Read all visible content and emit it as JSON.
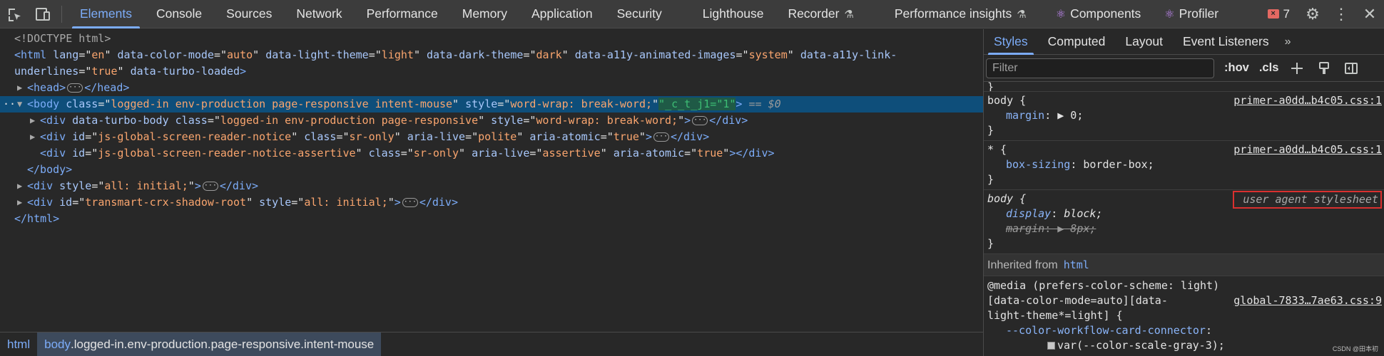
{
  "toolbar": {
    "tabs": [
      {
        "label": "Elements"
      },
      {
        "label": "Console"
      },
      {
        "label": "Sources"
      },
      {
        "label": "Network"
      },
      {
        "label": "Performance"
      },
      {
        "label": "Memory"
      },
      {
        "label": "Application"
      },
      {
        "label": "Security"
      },
      {
        "label": "Lighthouse"
      },
      {
        "label": "Recorder"
      },
      {
        "label": "Performance insights"
      },
      {
        "label": "Components"
      },
      {
        "label": "Profiler"
      }
    ],
    "active_tab": "Elements",
    "error_count": "7",
    "icons": [
      "inspect-element-icon",
      "device-toolbar-icon",
      "beaker-icon",
      "react-icon",
      "gear-icon",
      "kebab-menu-icon",
      "close-icon"
    ]
  },
  "dom": {
    "doctype": "<!DOCTYPE html>",
    "html_open": {
      "tag": "html",
      "attrs": [
        {
          "n": "lang",
          "v": "en"
        },
        {
          "n": "data-color-mode",
          "v": "auto"
        },
        {
          "n": "data-light-theme",
          "v": "light"
        },
        {
          "n": "data-dark-theme",
          "v": "dark"
        },
        {
          "n": "data-a11y-animated-images",
          "v": "system"
        },
        {
          "n": "data-a11y-link-underlines",
          "v": "true"
        }
      ],
      "bool_attr": "data-turbo-loaded"
    },
    "head": {
      "tag": "head",
      "close": "</head>"
    },
    "body_open": {
      "tag": "body",
      "class_name": "class",
      "class_value": "logged-in env-production page-responsive intent-mouse",
      "style_name": "style",
      "style_value": "word-wrap: break-word;",
      "highlight_text": "\"_c_t_j1=\"1\"",
      "eq_ref": "== $0"
    },
    "children": [
      {
        "tag": "div",
        "attrs": [
          {
            "n": "data-turbo-body",
            "v": null
          },
          {
            "n": "class",
            "v": "logged-in env-production page-responsive"
          },
          {
            "n": "style",
            "v": "word-wrap: break-word;"
          }
        ],
        "collapsed": true,
        "close": "</div>"
      },
      {
        "tag": "div",
        "attrs": [
          {
            "n": "id",
            "v": "js-global-screen-reader-notice"
          },
          {
            "n": "class",
            "v": "sr-only"
          },
          {
            "n": "aria-live",
            "v": "polite"
          },
          {
            "n": "aria-atomic",
            "v": "true"
          }
        ],
        "collapsed": true,
        "close": "</div>"
      },
      {
        "tag": "div",
        "attrs": [
          {
            "n": "id",
            "v": "js-global-screen-reader-notice-assertive"
          },
          {
            "n": "class",
            "v": "sr-only"
          },
          {
            "n": "aria-live",
            "v": "assertive"
          },
          {
            "n": "aria-atomic",
            "v": "true"
          }
        ],
        "collapsed": false,
        "close": "</div>"
      }
    ],
    "body_close": "</body>",
    "after_body": [
      {
        "tag": "div",
        "attrs": [
          {
            "n": "style",
            "v": "all: initial;"
          }
        ],
        "close": "</div>"
      },
      {
        "tag": "div",
        "attrs": [
          {
            "n": "id",
            "v": "transmart-crx-shadow-root"
          },
          {
            "n": "style",
            "v": "all: initial;"
          }
        ],
        "close": "</div>"
      }
    ],
    "html_close": "</html>"
  },
  "breadcrumbs": [
    {
      "tag": "html",
      "classes": ""
    },
    {
      "tag": "body",
      "classes": ".logged-in.env-production.page-responsive.intent-mouse"
    }
  ],
  "styles_pane": {
    "tabs": [
      {
        "label": "Styles"
      },
      {
        "label": "Computed"
      },
      {
        "label": "Layout"
      },
      {
        "label": "Event Listeners"
      }
    ],
    "more": "»",
    "filter_placeholder": "Filter",
    "hov": ":hov",
    "cls": ".cls",
    "rules": [
      {
        "selector": "body {",
        "source": "primer-a0dd…b4c05.css:1",
        "decls": [
          {
            "p": "margin",
            "v": "▶ 0;"
          }
        ],
        "close": "}"
      },
      {
        "selector": "* {",
        "source": "primer-a0dd…b4c05.css:1",
        "decls": [
          {
            "p": "box-sizing",
            "v": "border-box;"
          }
        ],
        "close": "}"
      },
      {
        "selector": "body {",
        "source": "user agent stylesheet",
        "decls": [
          {
            "p": "display",
            "v": "block;"
          },
          {
            "p": "margin",
            "v": "▶ 8px;",
            "struck": true
          }
        ],
        "close": "}"
      }
    ],
    "inherited_label": "Inherited from",
    "inherited_tag": "html",
    "media_query": "@media (prefers-color-scheme: light)",
    "media_selector_1": "[data-color-mode=auto][data-",
    "media_selector_2": "light-theme*=light] {",
    "media_source": "global-7833…7ae63.css:9",
    "media_decl_prop": "--color-workflow-card-connector",
    "media_decl_val": "var(--color-scale-gray-3);",
    "watermark": "CSDN @田本初"
  },
  "colors": {
    "accent": "#7cacf8",
    "selected_row": "#0e4e7a",
    "error": "#e46962",
    "highlight_border": "#d9302f"
  }
}
